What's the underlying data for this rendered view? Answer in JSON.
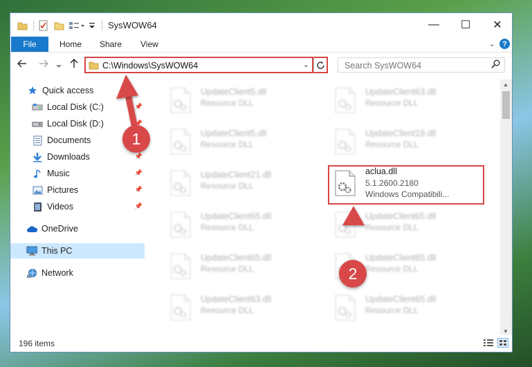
{
  "window": {
    "title": "SysWOW64",
    "controls": {
      "minimize": "—",
      "maximize": "☐",
      "close": "✕"
    }
  },
  "ribbon": {
    "file_label": "File",
    "tabs": [
      "Home",
      "Share",
      "View"
    ],
    "help": "?"
  },
  "nav": {
    "address": "C:\\Windows\\SysWOW64",
    "search_placeholder": "Search SysWOW64"
  },
  "sidebar": {
    "items": [
      {
        "label": "Quick access",
        "icon": "star-icon",
        "pinned": false
      },
      {
        "label": "Local Disk (C:)",
        "icon": "drive-icon",
        "pinned": true
      },
      {
        "label": "Local Disk (D:)",
        "icon": "drive-icon",
        "pinned": true
      },
      {
        "label": "Documents",
        "icon": "documents-icon",
        "pinned": true
      },
      {
        "label": "Downloads",
        "icon": "download-icon",
        "pinned": true
      },
      {
        "label": "Music",
        "icon": "music-icon",
        "pinned": true
      },
      {
        "label": "Pictures",
        "icon": "pictures-icon",
        "pinned": true
      },
      {
        "label": "Videos",
        "icon": "videos-icon",
        "pinned": true
      },
      {
        "label": "OneDrive",
        "icon": "cloud-icon",
        "pinned": false
      },
      {
        "label": "This PC",
        "icon": "computer-icon",
        "pinned": false,
        "selected": true
      },
      {
        "label": "Network",
        "icon": "network-icon",
        "pinned": false
      }
    ]
  },
  "files": {
    "left": [
      {
        "name": "UpdateClient5.dll",
        "type": "Resource DLL"
      },
      {
        "name": "UpdateClient5.dll",
        "type": "Resource DLL"
      },
      {
        "name": "UpdateClient21.dll",
        "type": "Resource DLL"
      },
      {
        "name": "UpdateClient65.dll",
        "type": "Resource DLL"
      },
      {
        "name": "UpdateClient65.dll",
        "type": "Resource DLL"
      },
      {
        "name": "UpdateClient63.dll",
        "type": "Resource DLL"
      }
    ],
    "right": [
      {
        "name": "UpdateClient63.dll",
        "type": "Resource DLL"
      },
      {
        "name": "UpdateClient19.dll",
        "type": "Resource DLL"
      },
      {
        "name": "aclua.dll",
        "version": "5.1.2600.2180",
        "type": "Windows Compatibili..."
      },
      {
        "name": "UpdateClient65.dll",
        "type": "Resource DLL"
      },
      {
        "name": "UpdateClient65.dll",
        "type": "Resource DLL"
      },
      {
        "name": "UpdateClient65.dll",
        "type": "Resource DLL"
      }
    ]
  },
  "status": {
    "item_count": "196 items"
  },
  "callouts": {
    "one": "1",
    "two": "2"
  },
  "colors": {
    "accent": "#1979ca",
    "highlight": "#d64545",
    "selection": "#cce8ff"
  }
}
